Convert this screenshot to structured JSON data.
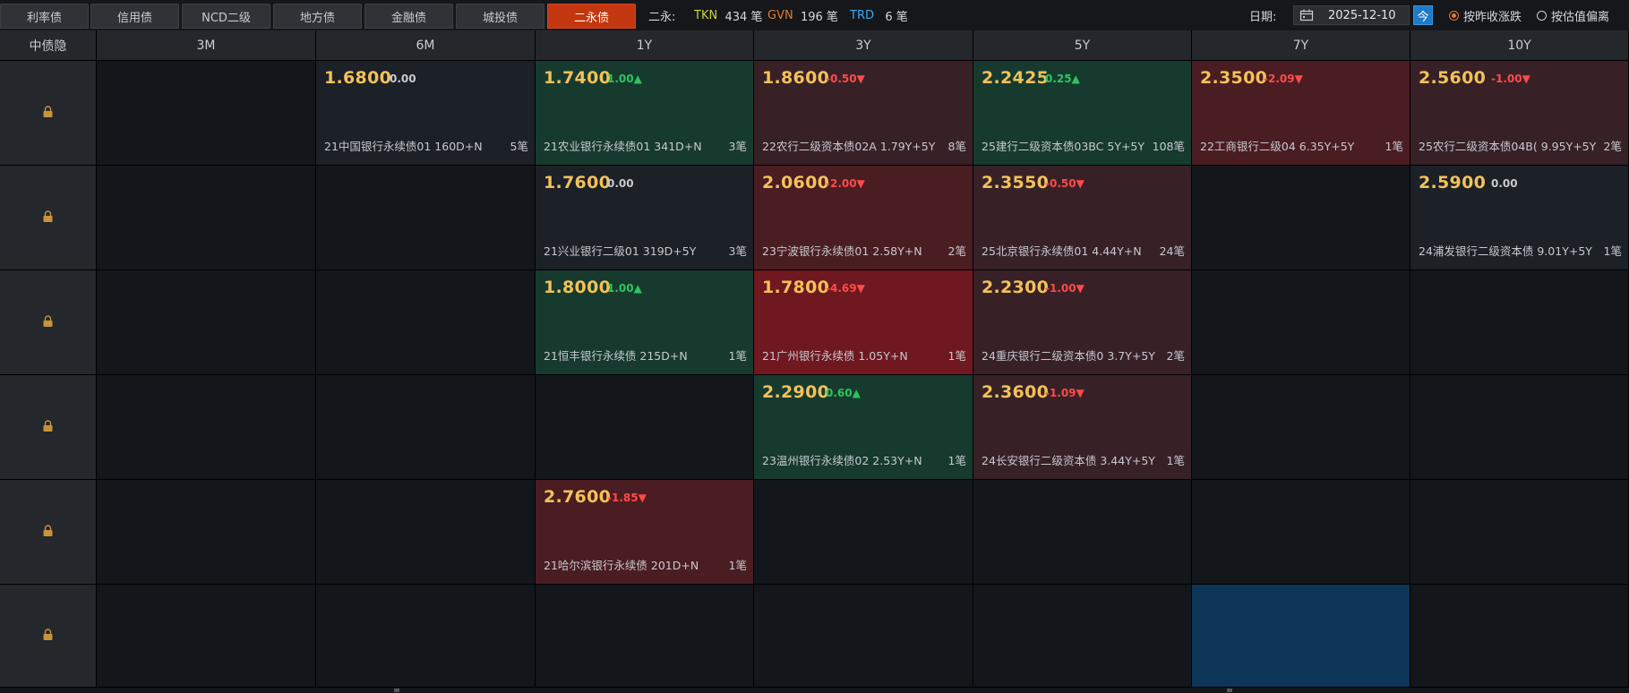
{
  "tabs": [
    "利率债",
    "信用债",
    "NCD二级",
    "地方债",
    "金融债",
    "城投债",
    "二永债"
  ],
  "active_tab": 6,
  "stats": {
    "label": "二永:",
    "tkn_label": "TKN",
    "tkn_value": "434 笔",
    "gvn_label": "GVN",
    "gvn_value": "196 笔",
    "trd_label": "TRD",
    "trd_value": "6 笔"
  },
  "date": {
    "label": "日期:",
    "value": "2025-12-10",
    "today_label": "今"
  },
  "radios": [
    {
      "label": "按昨收涨跌",
      "checked": true
    },
    {
      "label": "按估值偏离",
      "checked": false
    }
  ],
  "columns": [
    "中债隐",
    "3M",
    "6M",
    "1Y",
    "3Y",
    "5Y",
    "7Y",
    "10Y"
  ],
  "colors": {
    "accent": "#c2370f",
    "price": "#f3c15a",
    "up": "#2cc55f",
    "down": "#ff4a4a",
    "tkn": "#c8d53a",
    "gvn": "#e2792e",
    "trd": "#41a8ef"
  },
  "rows": [
    {
      "lock_icon": "lock-icon",
      "cells": [
        null,
        {
          "price": "1.6800",
          "change": "0.00",
          "dir": "flat",
          "name": "21中国银行永续债01 160D+N",
          "count": "5笔",
          "tone": "neutral"
        },
        {
          "price": "1.7400",
          "change": "1.00▲",
          "dir": "up",
          "name": "21农业银行永续债01 341D+N",
          "count": "3笔",
          "tone": "green"
        },
        {
          "price": "1.8600",
          "change": "-0.50▼",
          "dir": "down",
          "name": "22农行二级资本债02A 1.79Y+5Y",
          "count": "8笔",
          "tone": "red1"
        },
        {
          "price": "2.2425",
          "change": "0.25▲",
          "dir": "up",
          "name": "25建行二级资本债03BC 5Y+5Y",
          "count": "108笔",
          "tone": "green"
        },
        {
          "price": "2.3500",
          "change": "-2.09▼",
          "dir": "down",
          "name": "22工商银行二级04 6.35Y+5Y",
          "count": "1笔",
          "tone": "red2"
        },
        {
          "price": "2.5600",
          "change": "-1.00▼",
          "dir": "down",
          "name": "25农行二级资本债04B( 9.95Y+5Y",
          "count": "2笔",
          "tone": "red1"
        }
      ]
    },
    {
      "lock_icon": "lock-icon",
      "cells": [
        null,
        null,
        {
          "price": "1.7600",
          "change": "0.00",
          "dir": "flat",
          "name": "21兴业银行二级01 319D+5Y",
          "count": "3笔",
          "tone": "neutral"
        },
        {
          "price": "2.0600",
          "change": "-2.00▼",
          "dir": "down",
          "name": "23宁波银行永续债01 2.58Y+N",
          "count": "2笔",
          "tone": "red2"
        },
        {
          "price": "2.3550",
          "change": "-0.50▼",
          "dir": "down",
          "name": "25北京银行永续债01 4.44Y+N",
          "count": "24笔",
          "tone": "red1"
        },
        null,
        {
          "price": "2.5900",
          "change": "0.00",
          "dir": "flat",
          "name": "24浦发银行二级资本债 9.01Y+5Y",
          "count": "1笔",
          "tone": "neutral"
        }
      ]
    },
    {
      "lock_icon": "lock-icon",
      "cells": [
        null,
        null,
        {
          "price": "1.8000",
          "change": "1.00▲",
          "dir": "up",
          "name": "21恒丰银行永续债 215D+N",
          "count": "1笔",
          "tone": "green"
        },
        {
          "price": "1.7800",
          "change": "-4.69▼",
          "dir": "down",
          "name": "21广州银行永续债 1.05Y+N",
          "count": "1笔",
          "tone": "red3"
        },
        {
          "price": "2.2300",
          "change": "-1.00▼",
          "dir": "down",
          "name": "24重庆银行二级资本债0 3.7Y+5Y",
          "count": "2笔",
          "tone": "red1"
        },
        null,
        null
      ]
    },
    {
      "lock_icon": "lock-icon",
      "cells": [
        null,
        null,
        null,
        {
          "price": "2.2900",
          "change": "0.60▲",
          "dir": "up",
          "name": "23温州银行永续债02 2.53Y+N",
          "count": "1笔",
          "tone": "green"
        },
        {
          "price": "2.3600",
          "change": "-1.09▼",
          "dir": "down",
          "name": "24长安银行二级资本债 3.44Y+5Y",
          "count": "1笔",
          "tone": "red1"
        },
        null,
        null
      ]
    },
    {
      "lock_icon": "lock-icon",
      "cells": [
        null,
        null,
        {
          "price": "2.7600",
          "change": "-1.85▼",
          "dir": "down",
          "name": "21哈尔滨银行永续债 201D+N",
          "count": "1笔",
          "tone": "red2"
        },
        null,
        null,
        null,
        null
      ]
    },
    {
      "lock_icon": "lock-icon",
      "cells": [
        null,
        null,
        null,
        null,
        null,
        {
          "tone": "blue"
        },
        null
      ]
    }
  ]
}
